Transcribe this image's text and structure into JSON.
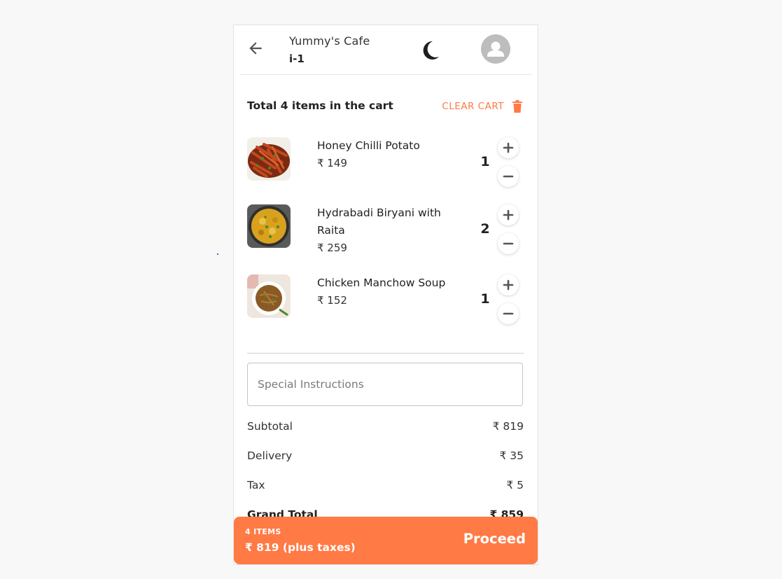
{
  "header": {
    "cafe_name": "Yummy's Cafe",
    "table_id": "i-1",
    "back_icon": "arrow-left-icon",
    "theme_icon": "moon-icon",
    "avatar_icon": "user-avatar-icon"
  },
  "cart": {
    "title": "Total 4 items in the cart",
    "clear_label": "CLEAR CART",
    "clear_icon": "trash-icon",
    "accent_color": "#ff7a45",
    "items": [
      {
        "name": "Honey Chilli Potato",
        "price": "₹ 149",
        "qty": "1"
      },
      {
        "name": "Hydrabadi Biryani with Raita",
        "price": "₹ 259",
        "qty": "2"
      },
      {
        "name": "Chicken Manchow Soup",
        "price": "₹ 152",
        "qty": "1"
      }
    ]
  },
  "instructions": {
    "placeholder": "Special Instructions",
    "value": ""
  },
  "summary": {
    "subtotal_label": "Subtotal",
    "subtotal": "₹ 819",
    "delivery_label": "Delivery",
    "delivery": "₹ 35",
    "tax_label": "Tax",
    "tax": "₹ 5",
    "grand_label": "Grand Total",
    "grand": "₹ 859"
  },
  "footer": {
    "items_count": "4 ITEMS",
    "total_text": "₹ 819 (plus taxes)",
    "proceed_label": "Proceed"
  }
}
